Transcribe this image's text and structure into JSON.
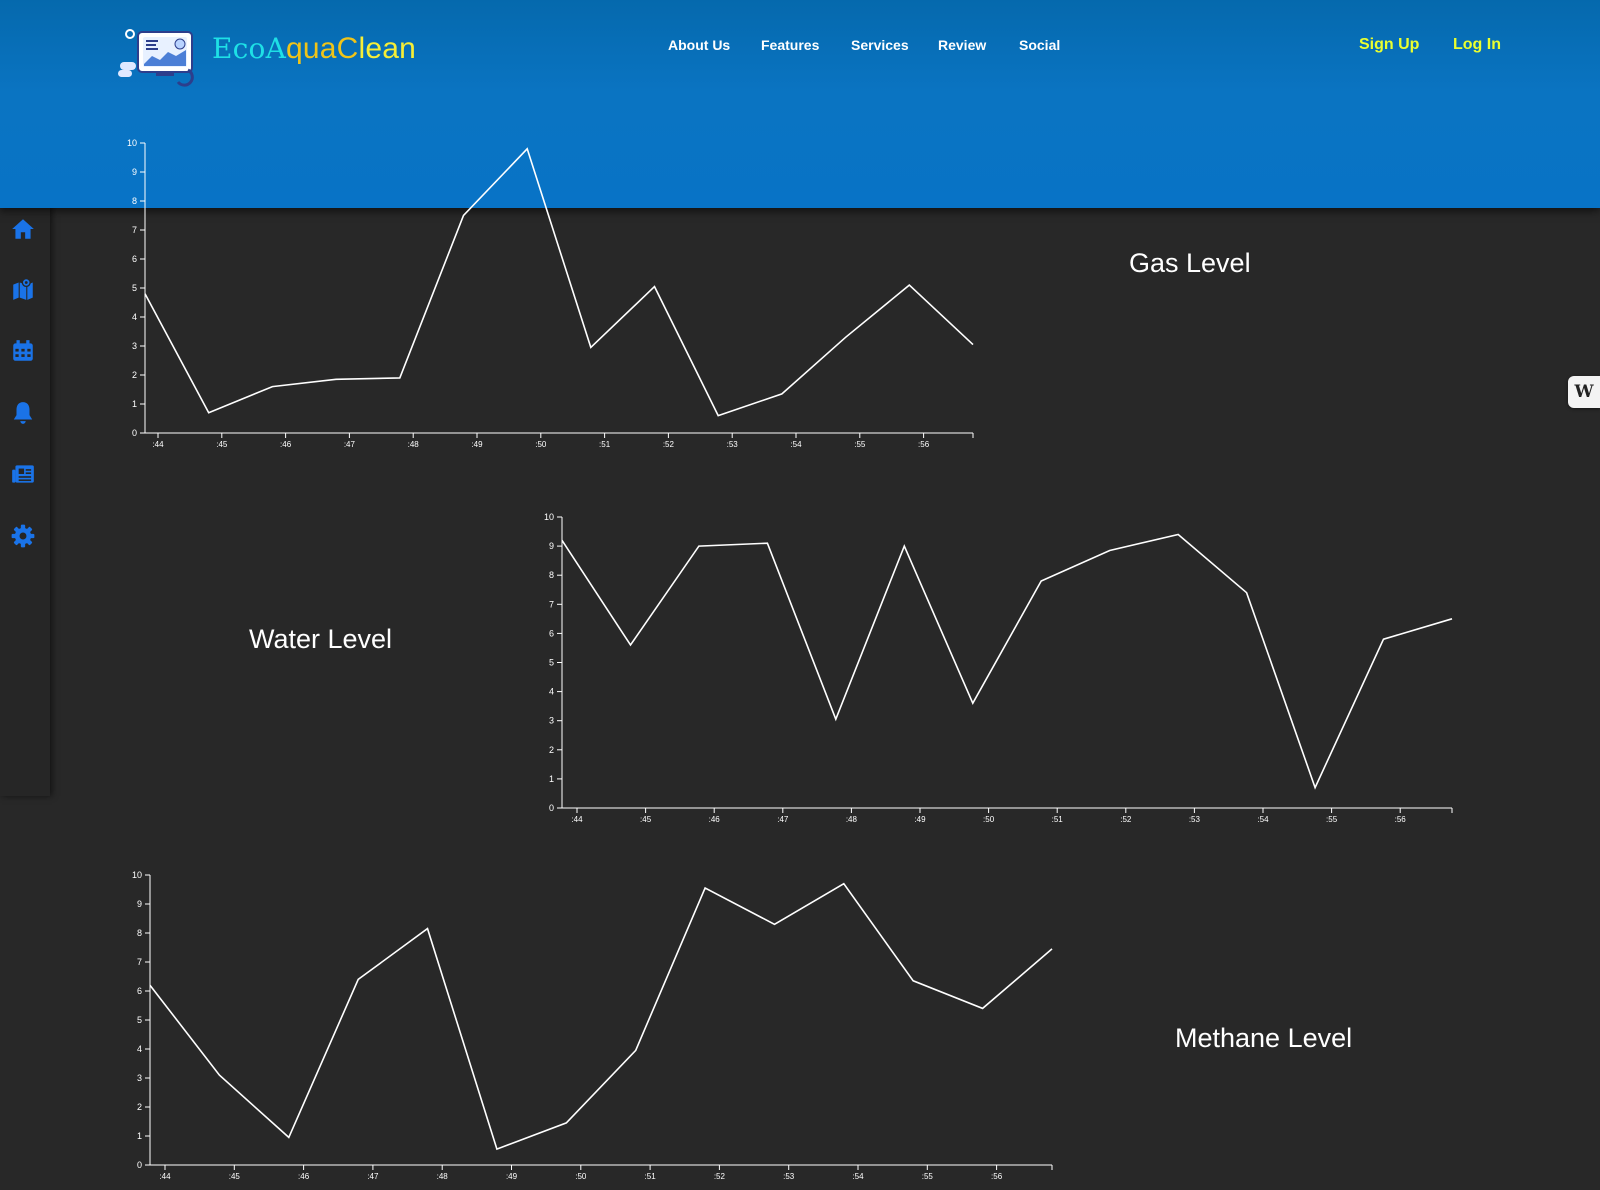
{
  "header": {
    "brand": {
      "part1": "EcoA",
      "part2": "quaC",
      "part3": "lean"
    },
    "nav": [
      "About Us",
      "Features",
      "Services",
      "Review",
      "Social"
    ],
    "auth": {
      "signup": "Sign Up",
      "login": "Log In"
    }
  },
  "sidebar": {
    "icons": [
      "home-icon",
      "map-icon",
      "calendar-icon",
      "bell-icon",
      "newspaper-icon",
      "gear-icon"
    ],
    "accent": "#1a73e8"
  },
  "colors": {
    "background": "#282828",
    "header": "#0873c6",
    "line": "#ffffff",
    "auth": "#eaff2f"
  },
  "widget": {
    "label": "W"
  },
  "chart_data": [
    {
      "type": "line",
      "title": "Gas Level",
      "x": [
        ":44",
        ":45",
        ":46",
        ":47",
        ":48",
        ":49",
        ":50",
        ":51",
        ":52",
        ":53",
        ":54",
        ":55",
        ":56"
      ],
      "values": [
        4.8,
        0.7,
        1.6,
        1.85,
        1.9,
        7.5,
        9.8,
        2.95,
        5.05,
        0.6,
        1.35,
        3.3,
        5.1,
        3.05
      ],
      "ylim": [
        0,
        10
      ],
      "yticks": [
        0,
        1,
        2,
        3,
        4,
        5,
        6,
        7,
        8,
        9,
        10
      ],
      "grid": false
    },
    {
      "type": "line",
      "title": "Water Level",
      "x": [
        ":44",
        ":45",
        ":46",
        ":47",
        ":48",
        ":49",
        ":50",
        ":51",
        ":52",
        ":53",
        ":54",
        ":55",
        ":56"
      ],
      "values": [
        9.2,
        5.6,
        9.0,
        9.1,
        3.05,
        9.0,
        3.6,
        7.8,
        8.85,
        9.4,
        7.4,
        0.7,
        5.8,
        6.5
      ],
      "ylim": [
        0,
        10
      ],
      "yticks": [
        0,
        1,
        2,
        3,
        4,
        5,
        6,
        7,
        8,
        9,
        10
      ],
      "grid": false
    },
    {
      "type": "line",
      "title": "Methane Level",
      "x": [
        ":44",
        ":45",
        ":46",
        ":47",
        ":48",
        ":49",
        ":50",
        ":51",
        ":52",
        ":53",
        ":54",
        ":55",
        ":56"
      ],
      "values": [
        6.2,
        3.1,
        0.95,
        6.4,
        8.15,
        0.55,
        1.45,
        3.95,
        9.55,
        8.3,
        9.7,
        6.35,
        5.4,
        7.45
      ],
      "ylim": [
        0,
        10
      ],
      "yticks": [
        0,
        1,
        2,
        3,
        4,
        5,
        6,
        7,
        8,
        9,
        10
      ],
      "grid": false
    }
  ]
}
